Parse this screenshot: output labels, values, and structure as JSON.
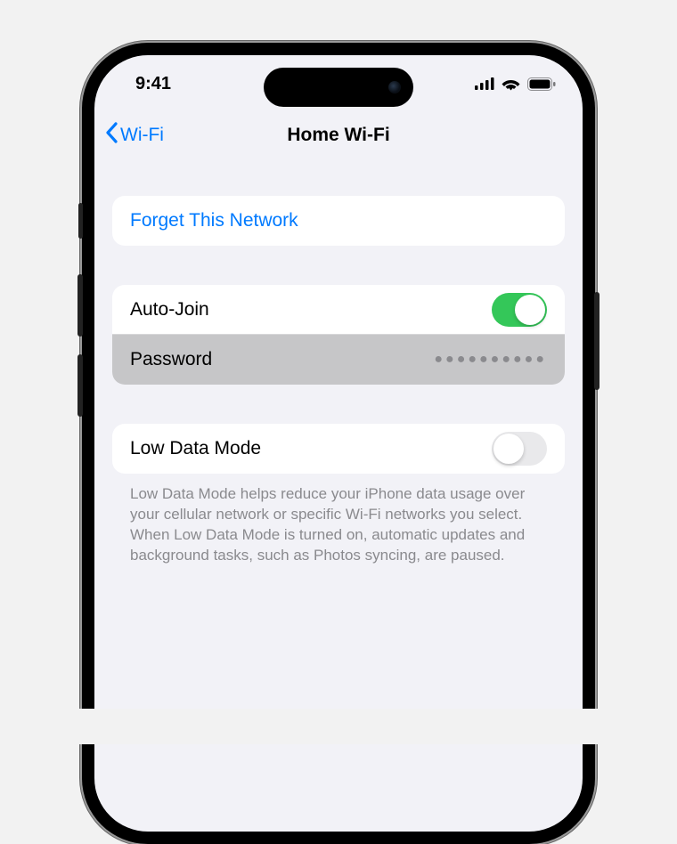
{
  "statusBar": {
    "time": "9:41"
  },
  "nav": {
    "backLabel": "Wi-Fi",
    "title": "Home Wi-Fi"
  },
  "sections": {
    "forget": {
      "label": "Forget This Network"
    },
    "network": {
      "autoJoin": {
        "label": "Auto-Join",
        "on": true
      },
      "password": {
        "label": "Password",
        "maskedValue": "●●●●●●●●●●"
      }
    },
    "lowData": {
      "label": "Low Data Mode",
      "on": false,
      "footer": "Low Data Mode helps reduce your iPhone data usage over your cellular network or specific Wi-Fi networks you select. When Low Data Mode is turned on, automatic updates and background tasks, such as Photos syncing, are paused."
    }
  }
}
